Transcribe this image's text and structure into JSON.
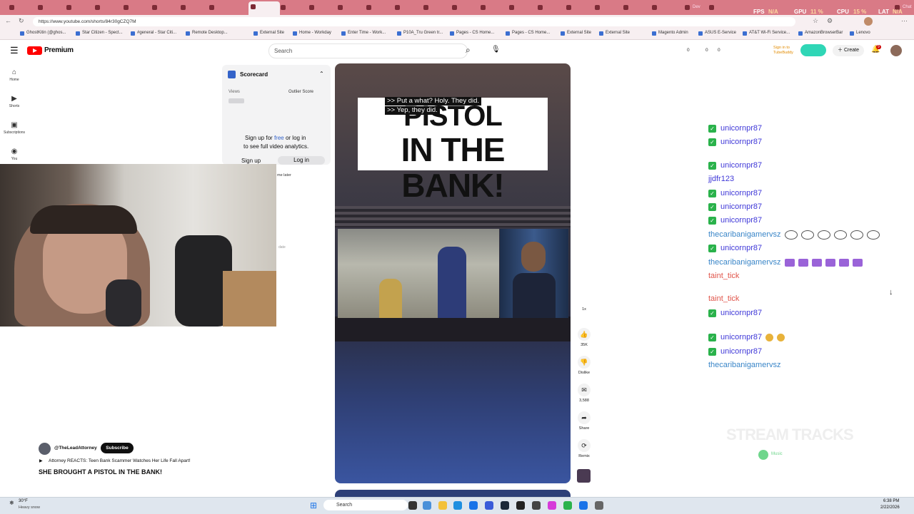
{
  "browser": {
    "url": "https://www.youtube.com/shorts/84r30gCZQ7M",
    "stats": [
      "FPS",
      "N/A",
      "GPU",
      "11 %",
      "CPU",
      "15 %",
      "LAT",
      "N/A"
    ],
    "tabs": [
      "Dev",
      "Chat"
    ],
    "bookmarks": [
      "GhostKitin (@ghos...",
      "Star Citizen - Spect...",
      "#general - Star Citi...",
      "Remote Desktop...",
      "External Site",
      "Home - Workday",
      "Enter Time - Work...",
      "P10A_Tru Green tr...",
      "Pages - CS Home...",
      "Pages - CS Home...",
      "External Site",
      "External Site",
      "Magento Admin",
      "ASUS E-Service",
      "AT&T Wi-Fi Service...",
      "AmazonBrowserBar",
      "Lenovo"
    ]
  },
  "youtube": {
    "logo": "Premium",
    "search_placeholder": "Search",
    "counts": [
      "0",
      "0",
      "0"
    ],
    "tubebuddy": "Sign in to TubeBuddy",
    "create": "Create",
    "notifications": "9",
    "nav": [
      "Home",
      "Shorts",
      "Subscriptions",
      "You"
    ]
  },
  "scorecard": {
    "title": "Scorecard",
    "views": "Views",
    "outlier": "Outlier Score",
    "signup_text_a": "Sign up for",
    "signup_free": "free",
    "signup_text_b": "or log in",
    "signup_text_c": "to see full video analytics.",
    "signup_btn": "Sign up",
    "login_btn": "Log in",
    "watch_later": "me later",
    "date": "date"
  },
  "video": {
    "title_line1": "PISTOL",
    "title_line2": "IN THE BANK!",
    "caption1": ">> Put a what? Holy. They did.",
    "caption2": ">> Yep, they did.",
    "channel": "@TheLeadAttorney",
    "subscribe": "Subscribe",
    "related": "Attorney REACTS: Teen Bank Scammer Watches Her Life Fall Apart!",
    "headline": "SHE BROUGHT A PISTOL IN THE BANK!",
    "speed": "1x",
    "rail": [
      {
        "icon": "thumb-up",
        "label": "35K"
      },
      {
        "icon": "thumb-down",
        "label": "Dislike"
      },
      {
        "icon": "comment",
        "label": "3,588"
      },
      {
        "icon": "share",
        "label": "Share"
      },
      {
        "icon": "remix",
        "label": "Remix"
      }
    ]
  },
  "chat": {
    "messages": [
      {
        "user": "unicornpr87",
        "badge": true,
        "style": "u1",
        "emotes": 0
      },
      {
        "user": "unicornpr87",
        "badge": true,
        "style": "u1",
        "emotes": 0
      },
      {
        "user": "unicornpr87",
        "badge": true,
        "style": "u1",
        "emotes": 0
      },
      {
        "user": "jjdfr123",
        "badge": false,
        "style": "u1",
        "emotes": 0
      },
      {
        "user": "unicornpr87",
        "badge": true,
        "style": "u1",
        "emotes": 0
      },
      {
        "user": "unicornpr87",
        "badge": true,
        "style": "u1",
        "emotes": 0
      },
      {
        "user": "unicornpr87",
        "badge": true,
        "style": "u1",
        "emotes": 0
      },
      {
        "user": "thecaribanigamervsz",
        "badge": false,
        "style": "u2",
        "emotes": 6,
        "emote_kind": "face"
      },
      {
        "user": "unicornpr87",
        "badge": true,
        "style": "u1",
        "emotes": 0
      },
      {
        "user": "thecaribanigamervsz",
        "badge": false,
        "style": "u2",
        "emotes": 6,
        "emote_kind": "camera"
      },
      {
        "user": "taint_tick",
        "badge": false,
        "style": "u3",
        "emotes": 0
      },
      {
        "user": "taint_tick",
        "badge": false,
        "style": "u3",
        "emotes": 0
      },
      {
        "user": "unicornpr87",
        "badge": true,
        "style": "u1",
        "emotes": 0
      },
      {
        "user": "unicornpr87",
        "badge": true,
        "style": "u1",
        "emotes": 2,
        "emote_kind": "smile"
      },
      {
        "user": "unicornpr87",
        "badge": true,
        "style": "u1",
        "emotes": 0
      },
      {
        "user": "thecaribanigamervsz",
        "badge": false,
        "style": "u2",
        "emotes": 0
      }
    ],
    "overlay": "STREAM TRACKS",
    "overlay_sub": "Music"
  },
  "taskbar": {
    "weather_temp": "30°F",
    "weather_desc": "Heavy snow",
    "search": "Search",
    "time": "6:38 PM",
    "date": "2/22/2026"
  }
}
